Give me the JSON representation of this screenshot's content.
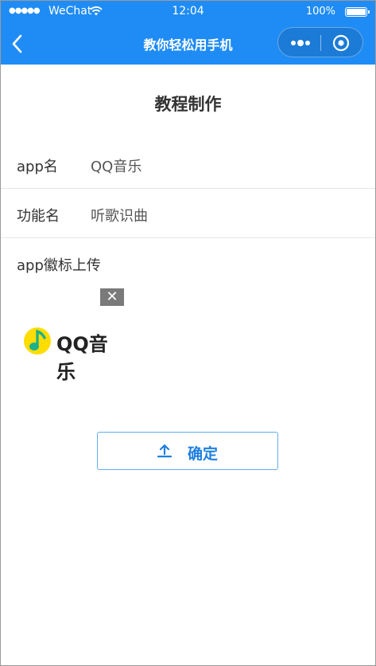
{
  "status_bar": {
    "signal_dots": "●●●●●",
    "carrier": "WeChat",
    "time": "12:04",
    "battery": "100%"
  },
  "nav": {
    "title": "教你轻松用手机",
    "back_icon": "chevron-left-icon",
    "more_icon": "more-dots-icon",
    "close_icon": "target-close-icon",
    "background_color": "#1f8cf5"
  },
  "page": {
    "title": "教程制作"
  },
  "form": {
    "app_name_label": "app名",
    "app_name_value": "QQ音乐",
    "function_label": "功能名",
    "function_value": "听歌识曲",
    "icon_upload_label": "app徽标上传",
    "delete_symbol": "✕"
  },
  "uploaded_logo": {
    "text": "QQ音乐",
    "icon": "qq-music-note-icon",
    "icon_color": "#ffdd00",
    "note_color": "#1db08a"
  },
  "confirm_button": {
    "label": "确定",
    "icon": "upload-icon",
    "color": "#1f7fe0"
  }
}
